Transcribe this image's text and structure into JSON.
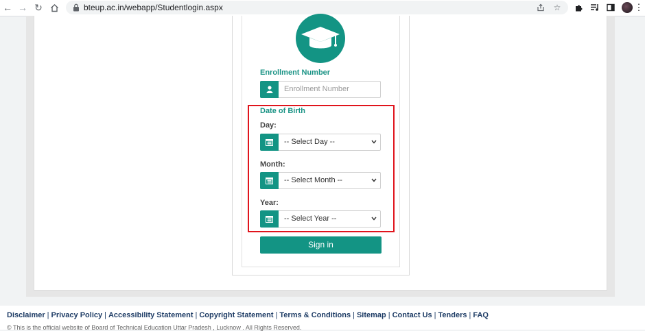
{
  "browser": {
    "url": "bteup.ac.in/webapp/Studentlogin.aspx"
  },
  "colors": {
    "accent": "#139484",
    "accent_text": "#1a9385",
    "highlight": "#e0141c",
    "footer_link": "#1f3d66"
  },
  "form": {
    "enrollment_label": "Enrollment Number",
    "enrollment_placeholder": "Enrollment Number",
    "dob_label": "Date of Birth",
    "day_label": "Day:",
    "day_value": "-- Select Day --",
    "month_label": "Month:",
    "month_value": "-- Select Month --",
    "year_label": "Year:",
    "year_value": "-- Select Year --",
    "signin_label": "Sign in"
  },
  "footer": {
    "links": [
      "Disclaimer",
      "Privacy Policy",
      "Accessibility Statement",
      "Copyright Statement",
      "Terms & Conditions",
      "Sitemap",
      "Contact Us",
      "Tenders",
      "FAQ"
    ],
    "note": "© This is the official website of Board of Technical Education Uttar Pradesh , Lucknow . All Rights Reserved."
  }
}
